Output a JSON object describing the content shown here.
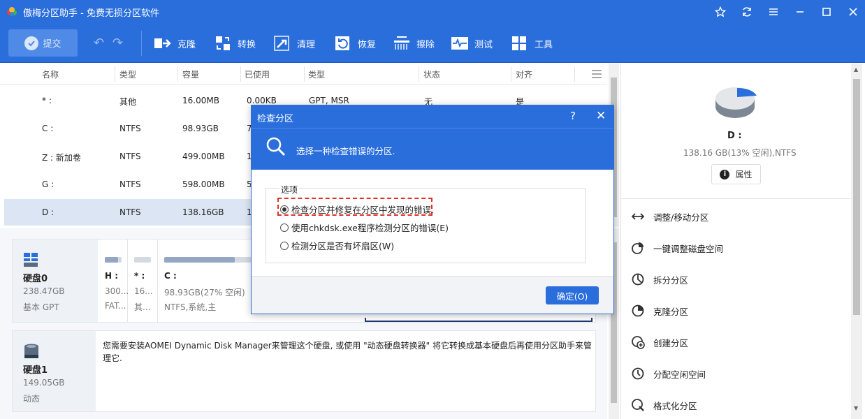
{
  "app": {
    "title": "傲梅分区助手 - 免费无损分区软件"
  },
  "colors": {
    "primary": "#2a6edc",
    "highlight": "#e0302a"
  },
  "toolbar": {
    "submit": "提交",
    "items": [
      {
        "label": "克隆",
        "icon": "clone-icon"
      },
      {
        "label": "转换",
        "icon": "convert-icon"
      },
      {
        "label": "清理",
        "icon": "cleanup-icon"
      },
      {
        "label": "恢复",
        "icon": "recover-icon"
      },
      {
        "label": "擦除",
        "icon": "wipe-icon"
      },
      {
        "label": "测试",
        "icon": "test-icon"
      },
      {
        "label": "工具",
        "icon": "tools-icon"
      }
    ]
  },
  "table": {
    "columns": [
      "名称",
      "类型",
      "容量",
      "已使用",
      "类型",
      "状态",
      "对齐"
    ],
    "rows": [
      {
        "name": "* :",
        "type": "其他",
        "size": "16.00MB",
        "used": "0.00KB",
        "fs": "GPT, MSR",
        "status": "无",
        "align": "是"
      },
      {
        "name": "C :",
        "type": "NTFS",
        "size": "98.93GB",
        "used": "7"
      },
      {
        "name": "Z : 新加卷",
        "type": "NTFS",
        "size": "499.00MB",
        "used": "1"
      },
      {
        "name": "G :",
        "type": "NTFS",
        "size": "598.00MB",
        "used": "5"
      },
      {
        "name": "D :",
        "type": "NTFS",
        "size": "138.16GB",
        "used": "1"
      }
    ]
  },
  "disks": [
    {
      "name": "硬盘0",
      "size": "238.47GB",
      "style": "基本 GPT",
      "badge": "SSD",
      "partitions": [
        {
          "label": "H :",
          "size": "300...",
          "fs": "FAT...",
          "fill": 0.8
        },
        {
          "label": "* :",
          "size": "16...",
          "fs": "其...",
          "fill": 0.0
        },
        {
          "label": "C :",
          "size": "98.93GB(27% 空闲)",
          "fs": "NTFS,系统,主",
          "fill": 0.73
        }
      ]
    },
    {
      "name": "硬盘1",
      "size": "149.05GB",
      "style": "动态",
      "badge": "HDD",
      "message": "您需要安装AOMEI Dynamic Disk Manager来管理这个硬盘, 或使用 \"动态硬盘转换器\" 将它转换成基本硬盘后再使用分区助手来管理它."
    }
  ],
  "right": {
    "drive": "D :",
    "info": "138.16 GB(13% 空闲),NTFS",
    "properties": "属性",
    "ops": [
      {
        "label": "调整/移动分区",
        "icon": "resize-move-icon"
      },
      {
        "label": "一键调整磁盘空间",
        "icon": "quick-adjust-icon"
      },
      {
        "label": "拆分分区",
        "icon": "split-partition-icon"
      },
      {
        "label": "克隆分区",
        "icon": "clone-partition-icon"
      },
      {
        "label": "创建分区",
        "icon": "create-partition-icon"
      },
      {
        "label": "分配空闲空间",
        "icon": "allocate-space-icon"
      },
      {
        "label": "格式化分区",
        "icon": "format-partition-icon"
      }
    ]
  },
  "dialog": {
    "title": "检查分区",
    "help": "?",
    "close": "✕",
    "description": "选择一种检查错误的分区.",
    "group": "选项",
    "options": [
      {
        "label": "检查分区并修复在分区中发现的错误.",
        "selected": true
      },
      {
        "label": "使用chkdsk.exe程序检测分区的错误(E)",
        "selected": false
      },
      {
        "label": "检测分区是否有坏扇区(W)",
        "selected": false
      }
    ],
    "ok": "确定(O)"
  }
}
